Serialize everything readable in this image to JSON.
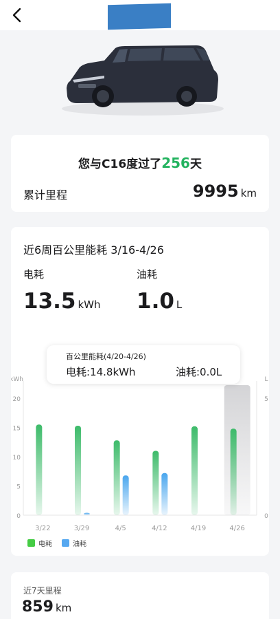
{
  "days": {
    "prefix": "您与C16度过了",
    "count": "256",
    "suffix": "天"
  },
  "mileage": {
    "label": "累计里程",
    "value": "9995",
    "unit": "km"
  },
  "energy": {
    "title": "近6周百公里能耗 3/16-4/26",
    "elec_label": "电耗",
    "fuel_label": "油耗",
    "elec_value": "13.5",
    "elec_unit": "kWh",
    "fuel_value": "1.0",
    "fuel_unit": "L"
  },
  "tooltip": {
    "title": "百公里能耗(4/20-4/26)",
    "elec": "电耗:14.8kWh",
    "fuel": "油耗:0.0L"
  },
  "chart_data": {
    "type": "bar",
    "categories": [
      "3/22",
      "3/29",
      "4/5",
      "4/12",
      "4/19",
      "4/26"
    ],
    "left_unit": "kWh",
    "right_unit": "L",
    "left_ticks": [
      "20",
      "15",
      "10",
      "5",
      "0"
    ],
    "right_ticks": [
      "5",
      "0"
    ],
    "ylim_left": [
      0,
      20
    ],
    "ylim_right": [
      0,
      5
    ],
    "selected_index": 5,
    "series": [
      {
        "name": "电耗",
        "axis": "left",
        "color": "#3dbb6a",
        "values": [
          15.5,
          15.3,
          12.8,
          11.0,
          15.2,
          14.8
        ]
      },
      {
        "name": "油耗",
        "axis": "right",
        "color": "#4aa6ee",
        "values": [
          0.0,
          0.1,
          1.7,
          1.8,
          0.0,
          0.0
        ]
      }
    ],
    "legend": [
      {
        "label": "电耗",
        "color": "#45cc44"
      },
      {
        "label": "油耗",
        "color": "#56a8f0"
      }
    ]
  },
  "week": {
    "label": "近7天里程",
    "value": "859",
    "unit": "km"
  }
}
